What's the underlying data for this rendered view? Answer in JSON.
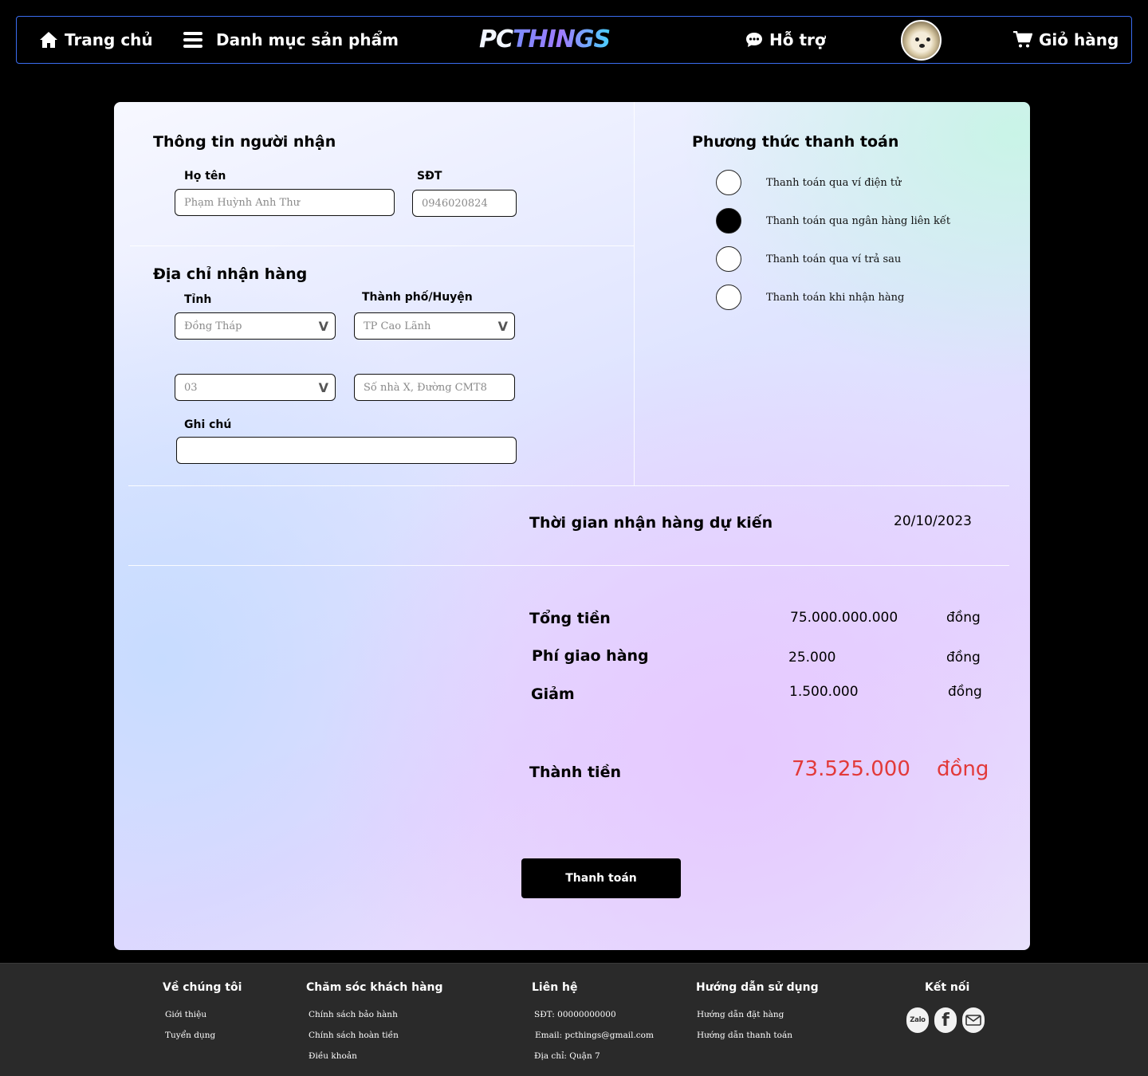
{
  "nav": {
    "home_label": "Trang chủ",
    "categories_label": "Danh mục sản phẩm",
    "logo_pc": "PC",
    "logo_things": "THINGS",
    "support_label": "Hỗ trợ",
    "cart_label": "Giỏ hàng"
  },
  "recipient": {
    "title": "Thông tin người nhận",
    "name_label": "Họ tên",
    "name_value": "Phạm Huỳnh Anh Thư",
    "phone_label": "SĐT",
    "phone_value": "0946020824"
  },
  "address": {
    "title": "Địa chỉ nhận hàng",
    "province_label": "Tỉnh",
    "province_value": "Đồng Tháp",
    "city_label": "Thành phố/Huyện",
    "city_value": "TP Cao Lãnh",
    "ward_value": "03",
    "street_value": "Số nhà X, Đường CMT8",
    "note_label": "Ghi chú",
    "note_value": "",
    "chevron": "V"
  },
  "payment": {
    "title": "Phương thức thanh toán",
    "methods": [
      {
        "label": "Thanh toán qua ví điện tử",
        "selected": false
      },
      {
        "label": "Thanh toán qua ngân hàng liên kết",
        "selected": true
      },
      {
        "label": "Thanh toán qua ví trả sau",
        "selected": false
      },
      {
        "label": "Thanh toán khi nhận hàng",
        "selected": false
      }
    ]
  },
  "delivery": {
    "label": "Thời gian nhận hàng dự kiến",
    "date": "20/10/2023"
  },
  "summary": {
    "subtotal_label": "Tổng tiền",
    "subtotal_value": "75.000.000.000",
    "shipping_label": "Phí giao hàng",
    "shipping_value": "25.000",
    "discount_label": "Giảm",
    "discount_value": "1.500.000",
    "unit": "đồng",
    "total_label": "Thành tiền",
    "total_value": "73.525.000",
    "total_unit": "đồng",
    "total_color": "#e23a3a"
  },
  "pay_button_label": "Thanh toán",
  "footer": {
    "about": {
      "title": "Về chúng tôi",
      "links": [
        "Giới thiệu",
        "Tuyển dụng"
      ]
    },
    "care": {
      "title": "Chăm sóc khách hàng",
      "links": [
        "Chính sách bảo hành",
        "Chính sách hoàn tiền",
        "Điều khoản"
      ]
    },
    "contact": {
      "title": "Liên hệ",
      "lines": [
        "SĐT: 00000000000",
        "Email: pcthings@gmail.com",
        "Địa chỉ: Quận 7"
      ]
    },
    "guide": {
      "title": "Hướng dẫn sử dụng",
      "links": [
        "Hướng dẫn đặt hàng",
        "Hướng dẫn thanh toán"
      ]
    },
    "connect": {
      "title": "Kết nối",
      "zalo_label": "Zalo",
      "facebook_label": "f"
    }
  },
  "colors": {
    "nav_border": "#3a6df0",
    "accent_red": "#e23a3a"
  }
}
